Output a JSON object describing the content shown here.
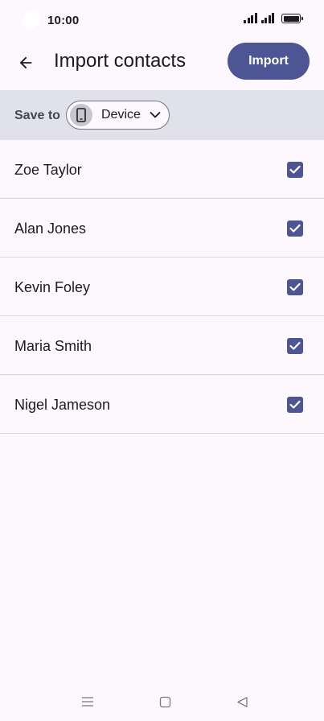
{
  "status_bar": {
    "time": "10:00"
  },
  "app_bar": {
    "title": "Import contacts",
    "import_label": "Import"
  },
  "save_to": {
    "label": "Save to",
    "selected": "Device"
  },
  "contacts": [
    {
      "name": "Zoe Taylor",
      "checked": true
    },
    {
      "name": "Alan Jones",
      "checked": true
    },
    {
      "name": "Kevin Foley",
      "checked": true
    },
    {
      "name": "Maria Smith",
      "checked": true
    },
    {
      "name": "Nigel Jameson",
      "checked": true
    }
  ],
  "icons": {
    "back": "arrow-back-icon",
    "device": "phone-icon",
    "dropdown": "chevron-down-icon",
    "check": "check-icon",
    "nav_recents": "menu-lines-icon",
    "nav_home": "square-icon",
    "nav_back": "triangle-back-icon"
  },
  "colors": {
    "accent": "#4d5594",
    "background": "#fcf8fd",
    "save_bar": "#e1e1ec",
    "divider": "#d6d6de"
  }
}
